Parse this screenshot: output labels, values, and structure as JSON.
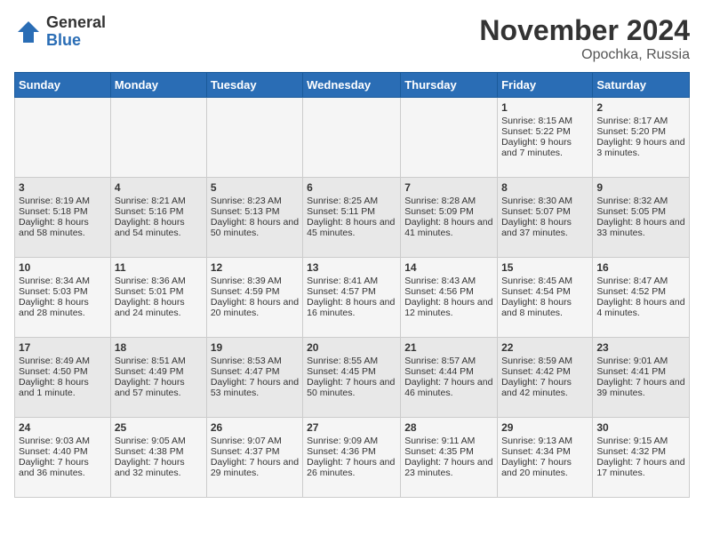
{
  "logo": {
    "general": "General",
    "blue": "Blue"
  },
  "title": "November 2024",
  "location": "Opochka, Russia",
  "days_of_week": [
    "Sunday",
    "Monday",
    "Tuesday",
    "Wednesday",
    "Thursday",
    "Friday",
    "Saturday"
  ],
  "weeks": [
    [
      {
        "day": "",
        "content": ""
      },
      {
        "day": "",
        "content": ""
      },
      {
        "day": "",
        "content": ""
      },
      {
        "day": "",
        "content": ""
      },
      {
        "day": "",
        "content": ""
      },
      {
        "day": "1",
        "content": "Sunrise: 8:15 AM\nSunset: 5:22 PM\nDaylight: 9 hours and 7 minutes."
      },
      {
        "day": "2",
        "content": "Sunrise: 8:17 AM\nSunset: 5:20 PM\nDaylight: 9 hours and 3 minutes."
      }
    ],
    [
      {
        "day": "3",
        "content": "Sunrise: 8:19 AM\nSunset: 5:18 PM\nDaylight: 8 hours and 58 minutes."
      },
      {
        "day": "4",
        "content": "Sunrise: 8:21 AM\nSunset: 5:16 PM\nDaylight: 8 hours and 54 minutes."
      },
      {
        "day": "5",
        "content": "Sunrise: 8:23 AM\nSunset: 5:13 PM\nDaylight: 8 hours and 50 minutes."
      },
      {
        "day": "6",
        "content": "Sunrise: 8:25 AM\nSunset: 5:11 PM\nDaylight: 8 hours and 45 minutes."
      },
      {
        "day": "7",
        "content": "Sunrise: 8:28 AM\nSunset: 5:09 PM\nDaylight: 8 hours and 41 minutes."
      },
      {
        "day": "8",
        "content": "Sunrise: 8:30 AM\nSunset: 5:07 PM\nDaylight: 8 hours and 37 minutes."
      },
      {
        "day": "9",
        "content": "Sunrise: 8:32 AM\nSunset: 5:05 PM\nDaylight: 8 hours and 33 minutes."
      }
    ],
    [
      {
        "day": "10",
        "content": "Sunrise: 8:34 AM\nSunset: 5:03 PM\nDaylight: 8 hours and 28 minutes."
      },
      {
        "day": "11",
        "content": "Sunrise: 8:36 AM\nSunset: 5:01 PM\nDaylight: 8 hours and 24 minutes."
      },
      {
        "day": "12",
        "content": "Sunrise: 8:39 AM\nSunset: 4:59 PM\nDaylight: 8 hours and 20 minutes."
      },
      {
        "day": "13",
        "content": "Sunrise: 8:41 AM\nSunset: 4:57 PM\nDaylight: 8 hours and 16 minutes."
      },
      {
        "day": "14",
        "content": "Sunrise: 8:43 AM\nSunset: 4:56 PM\nDaylight: 8 hours and 12 minutes."
      },
      {
        "day": "15",
        "content": "Sunrise: 8:45 AM\nSunset: 4:54 PM\nDaylight: 8 hours and 8 minutes."
      },
      {
        "day": "16",
        "content": "Sunrise: 8:47 AM\nSunset: 4:52 PM\nDaylight: 8 hours and 4 minutes."
      }
    ],
    [
      {
        "day": "17",
        "content": "Sunrise: 8:49 AM\nSunset: 4:50 PM\nDaylight: 8 hours and 1 minute."
      },
      {
        "day": "18",
        "content": "Sunrise: 8:51 AM\nSunset: 4:49 PM\nDaylight: 7 hours and 57 minutes."
      },
      {
        "day": "19",
        "content": "Sunrise: 8:53 AM\nSunset: 4:47 PM\nDaylight: 7 hours and 53 minutes."
      },
      {
        "day": "20",
        "content": "Sunrise: 8:55 AM\nSunset: 4:45 PM\nDaylight: 7 hours and 50 minutes."
      },
      {
        "day": "21",
        "content": "Sunrise: 8:57 AM\nSunset: 4:44 PM\nDaylight: 7 hours and 46 minutes."
      },
      {
        "day": "22",
        "content": "Sunrise: 8:59 AM\nSunset: 4:42 PM\nDaylight: 7 hours and 42 minutes."
      },
      {
        "day": "23",
        "content": "Sunrise: 9:01 AM\nSunset: 4:41 PM\nDaylight: 7 hours and 39 minutes."
      }
    ],
    [
      {
        "day": "24",
        "content": "Sunrise: 9:03 AM\nSunset: 4:40 PM\nDaylight: 7 hours and 36 minutes."
      },
      {
        "day": "25",
        "content": "Sunrise: 9:05 AM\nSunset: 4:38 PM\nDaylight: 7 hours and 32 minutes."
      },
      {
        "day": "26",
        "content": "Sunrise: 9:07 AM\nSunset: 4:37 PM\nDaylight: 7 hours and 29 minutes."
      },
      {
        "day": "27",
        "content": "Sunrise: 9:09 AM\nSunset: 4:36 PM\nDaylight: 7 hours and 26 minutes."
      },
      {
        "day": "28",
        "content": "Sunrise: 9:11 AM\nSunset: 4:35 PM\nDaylight: 7 hours and 23 minutes."
      },
      {
        "day": "29",
        "content": "Sunrise: 9:13 AM\nSunset: 4:34 PM\nDaylight: 7 hours and 20 minutes."
      },
      {
        "day": "30",
        "content": "Sunrise: 9:15 AM\nSunset: 4:32 PM\nDaylight: 7 hours and 17 minutes."
      }
    ]
  ]
}
